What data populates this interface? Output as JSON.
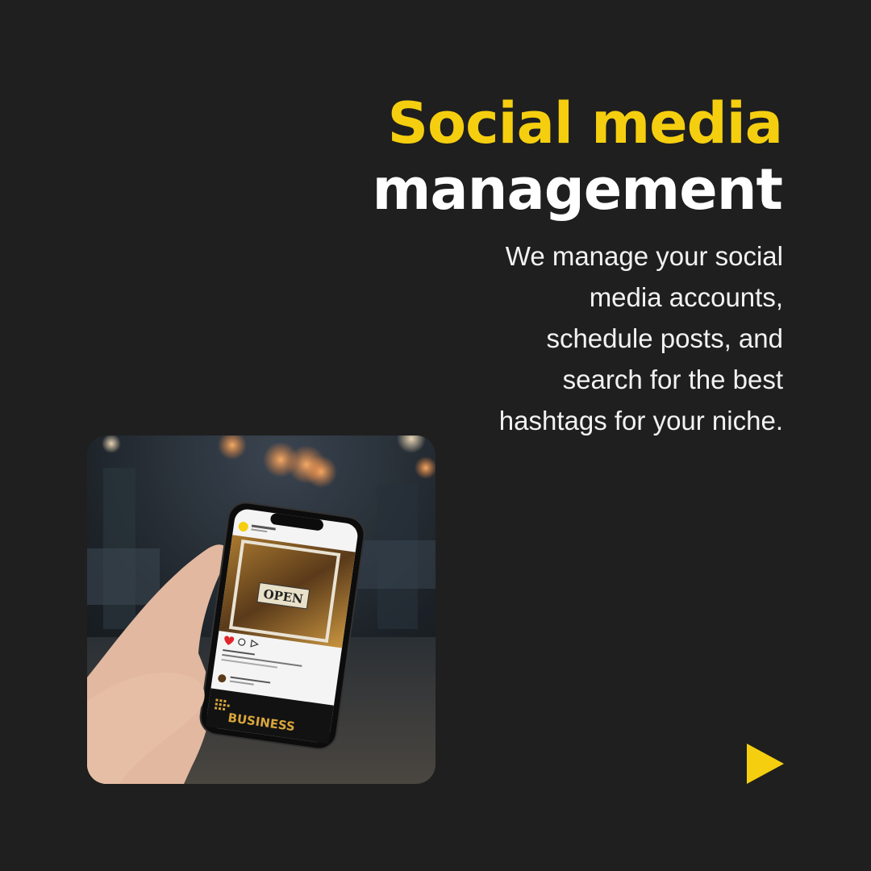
{
  "heading": {
    "line1": "Social media",
    "line2": "management"
  },
  "description": {
    "lines": [
      "We manage your social",
      "media accounts,",
      "schedule posts, and",
      "search for the best",
      "hashtags for your niche."
    ]
  },
  "photo": {
    "sign_text": "OPEN",
    "footer_text": "BUSINESS"
  },
  "colors": {
    "background": "#1f1f1f",
    "accent": "#f5cf0f",
    "text": "#ffffff"
  },
  "next_icon": "play-triangle-icon"
}
